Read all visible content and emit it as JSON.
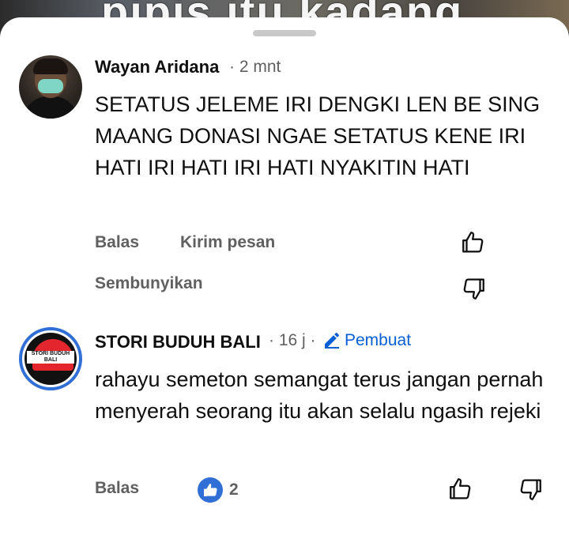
{
  "background": {
    "video_overlay_text": "pipis itu kadang"
  },
  "comments": [
    {
      "author": "Wayan Aridana",
      "time": "· 2 mnt",
      "text": "SETATUS JELEME IRI DENGKI LEN BE SING MAANG DONASI NGAE SETATUS KENE IRI HATI IRI HATI IRI HATI NYAKITIN HATI",
      "actions": {
        "reply": "Balas",
        "message": "Kirim pesan",
        "hide": "Sembunyikan"
      }
    },
    {
      "author": "STORI BUDUH BALI",
      "time": "· 16 j ·",
      "creator_badge": "Pembuat",
      "avatar_text": "STORI BUDUH BALI",
      "text": "rahayu semeton semangat terus jangan pernah menyerah seorang itu akan selalu ngasih rejeki",
      "actions": {
        "reply": "Balas"
      },
      "like_count": "2"
    }
  ],
  "colors": {
    "accent": "#065fd4",
    "like_badge": "#2f6fd6",
    "secondary_text": "#606060"
  }
}
